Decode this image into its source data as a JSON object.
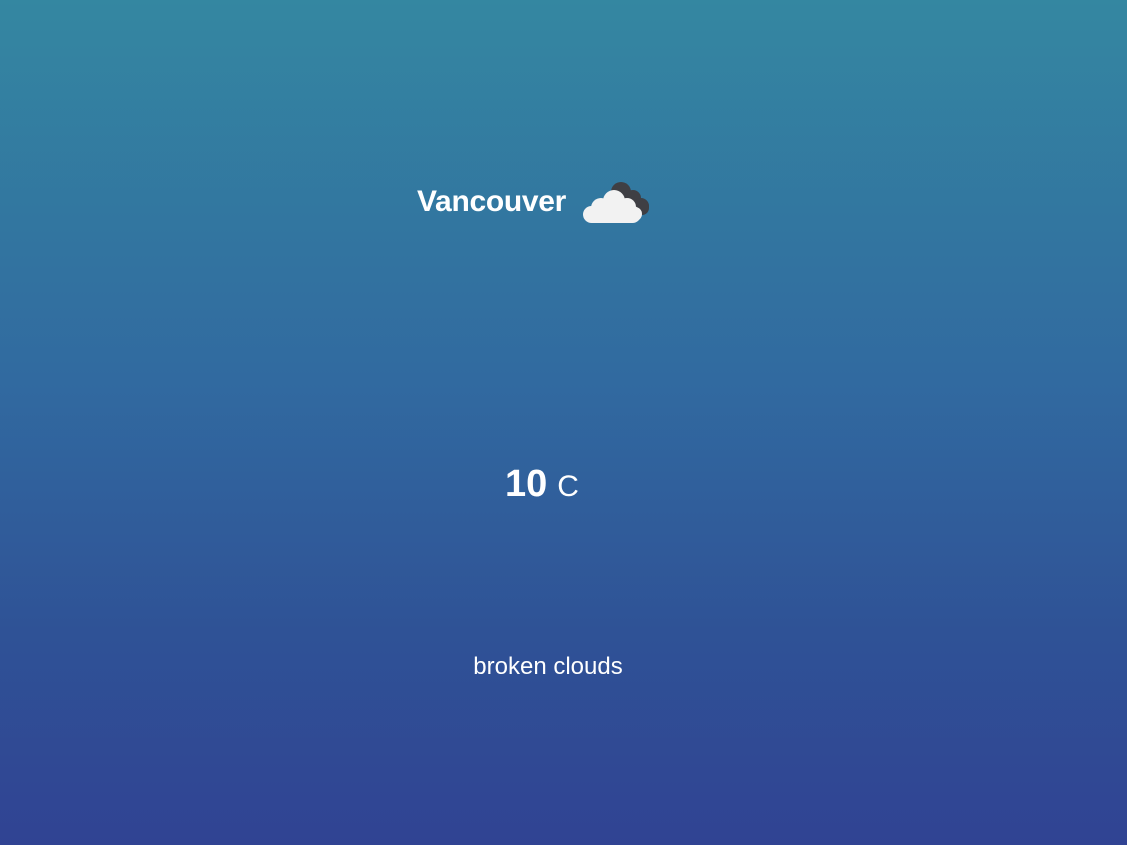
{
  "location": {
    "city": "Vancouver"
  },
  "conditions": {
    "icon": "broken-clouds-icon",
    "temperature": "10",
    "unit": "C",
    "description": "broken clouds"
  },
  "colors": {
    "gradient_top": "#3487a1",
    "gradient_bottom": "#304393",
    "text": "#ffffff",
    "cloud_light": "#f2f2f2",
    "cloud_dark": "#3f3f44"
  }
}
